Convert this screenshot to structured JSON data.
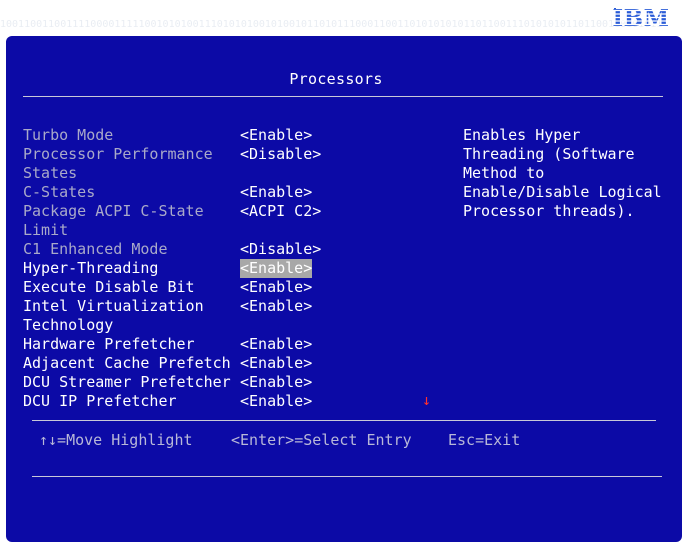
{
  "background": {
    "binary_rows": [
      "10011001100111100001111100101010011101010100101001011010111000110011010101010110110011101010101101100110101011",
      "10011110010000111100101100110100101010100110101001010110100011011010110001101010110001110101110010110110000101",
      "01101010011001101011100101000111010101100110110010101010101010110101010110010101010101010101001101010101010100",
      "11010101001010100110101001101010101010100110101001101010101010101010011010110010101011001101010100101010101010"
    ]
  },
  "logo": {
    "text": "IBM",
    "color": "#2a5bd7"
  },
  "window": {
    "title": "Processors"
  },
  "settings": [
    {
      "label": "Turbo Mode",
      "value": "<Enable>",
      "state": "disabled",
      "selected": false
    },
    {
      "label": "Processor Performance States",
      "value": "<Disable>",
      "state": "disabled",
      "selected": false
    },
    {
      "label": "C-States",
      "value": "<Enable>",
      "state": "disabled",
      "selected": false
    },
    {
      "label": "Package ACPI C-State Limit",
      "value": "<ACPI C2>",
      "state": "disabled",
      "selected": false
    },
    {
      "label": "C1 Enhanced Mode",
      "value": "<Disable>",
      "state": "disabled",
      "selected": false
    },
    {
      "label": "Hyper-Threading",
      "value": "<Enable>",
      "state": "enabled",
      "selected": true
    },
    {
      "label": "Execute Disable Bit",
      "value": "<Enable>",
      "state": "enabled",
      "selected": false
    },
    {
      "label": "Intel Virtualization Technology",
      "value": "<Enable>",
      "state": "enabled",
      "selected": false
    },
    {
      "label": "Hardware Prefetcher",
      "value": "<Enable>",
      "state": "enabled",
      "selected": false
    },
    {
      "label": "Adjacent Cache Prefetch",
      "value": "<Enable>",
      "state": "enabled",
      "selected": false
    },
    {
      "label": "DCU Streamer Prefetcher",
      "value": "<Enable>",
      "state": "enabled",
      "selected": false
    },
    {
      "label": "DCU IP Prefetcher",
      "value": "<Enable>",
      "state": "enabled",
      "selected": false
    }
  ],
  "help": {
    "lines": [
      "Enables Hyper",
      "Threading (Software",
      "Method to",
      "Enable/Disable Logical",
      "Processor threads)."
    ]
  },
  "scroll": {
    "indicator": "↓",
    "color": "#ff3030"
  },
  "footer": {
    "move": "↑↓=Move Highlight",
    "select": "<Enter>=Select Entry",
    "escape": "Esc=Exit"
  },
  "colors": {
    "background": "#0c0aa6",
    "selected_highlight": "#a8a8a8",
    "disabled_text": "#a9a9c9",
    "text": "#ffffff"
  }
}
